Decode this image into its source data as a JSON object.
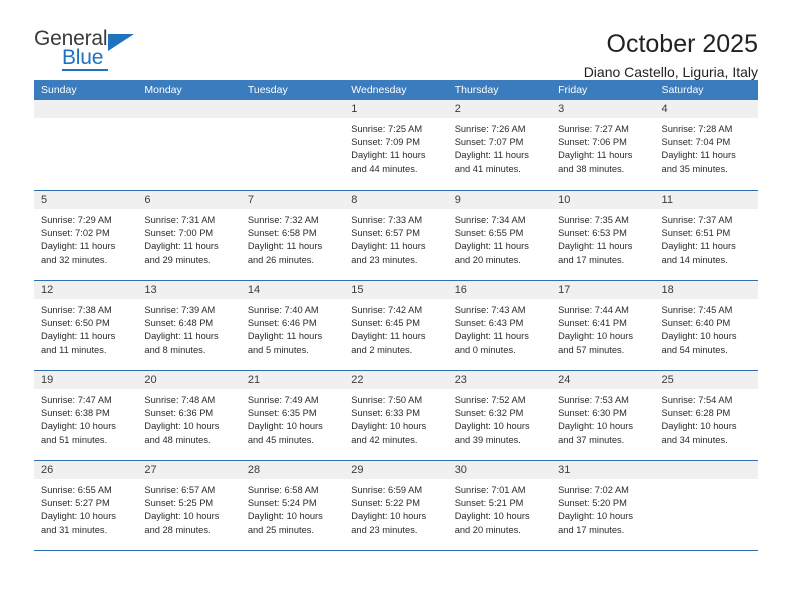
{
  "brand": {
    "name_top": "General",
    "name_bottom": "Blue",
    "accent_color": "#1f72bd",
    "triangle_icon": "triangle-icon"
  },
  "header": {
    "title": "October 2025",
    "subtitle": "Diano Castello, Liguria, Italy"
  },
  "calendar": {
    "header_bg": "#3a7cbe",
    "row_rule_color": "#2f6fb0",
    "day_strip_bg": "#f0f0f0",
    "weekdays": [
      "Sunday",
      "Monday",
      "Tuesday",
      "Wednesday",
      "Thursday",
      "Friday",
      "Saturday"
    ],
    "weeks": [
      [
        {
          "day": "",
          "lines": []
        },
        {
          "day": "",
          "lines": []
        },
        {
          "day": "",
          "lines": []
        },
        {
          "day": "1",
          "lines": [
            "Sunrise: 7:25 AM",
            "Sunset: 7:09 PM",
            "Daylight: 11 hours",
            "and 44 minutes."
          ]
        },
        {
          "day": "2",
          "lines": [
            "Sunrise: 7:26 AM",
            "Sunset: 7:07 PM",
            "Daylight: 11 hours",
            "and 41 minutes."
          ]
        },
        {
          "day": "3",
          "lines": [
            "Sunrise: 7:27 AM",
            "Sunset: 7:06 PM",
            "Daylight: 11 hours",
            "and 38 minutes."
          ]
        },
        {
          "day": "4",
          "lines": [
            "Sunrise: 7:28 AM",
            "Sunset: 7:04 PM",
            "Daylight: 11 hours",
            "and 35 minutes."
          ]
        }
      ],
      [
        {
          "day": "5",
          "lines": [
            "Sunrise: 7:29 AM",
            "Sunset: 7:02 PM",
            "Daylight: 11 hours",
            "and 32 minutes."
          ]
        },
        {
          "day": "6",
          "lines": [
            "Sunrise: 7:31 AM",
            "Sunset: 7:00 PM",
            "Daylight: 11 hours",
            "and 29 minutes."
          ]
        },
        {
          "day": "7",
          "lines": [
            "Sunrise: 7:32 AM",
            "Sunset: 6:58 PM",
            "Daylight: 11 hours",
            "and 26 minutes."
          ]
        },
        {
          "day": "8",
          "lines": [
            "Sunrise: 7:33 AM",
            "Sunset: 6:57 PM",
            "Daylight: 11 hours",
            "and 23 minutes."
          ]
        },
        {
          "day": "9",
          "lines": [
            "Sunrise: 7:34 AM",
            "Sunset: 6:55 PM",
            "Daylight: 11 hours",
            "and 20 minutes."
          ]
        },
        {
          "day": "10",
          "lines": [
            "Sunrise: 7:35 AM",
            "Sunset: 6:53 PM",
            "Daylight: 11 hours",
            "and 17 minutes."
          ]
        },
        {
          "day": "11",
          "lines": [
            "Sunrise: 7:37 AM",
            "Sunset: 6:51 PM",
            "Daylight: 11 hours",
            "and 14 minutes."
          ]
        }
      ],
      [
        {
          "day": "12",
          "lines": [
            "Sunrise: 7:38 AM",
            "Sunset: 6:50 PM",
            "Daylight: 11 hours",
            "and 11 minutes."
          ]
        },
        {
          "day": "13",
          "lines": [
            "Sunrise: 7:39 AM",
            "Sunset: 6:48 PM",
            "Daylight: 11 hours",
            "and 8 minutes."
          ]
        },
        {
          "day": "14",
          "lines": [
            "Sunrise: 7:40 AM",
            "Sunset: 6:46 PM",
            "Daylight: 11 hours",
            "and 5 minutes."
          ]
        },
        {
          "day": "15",
          "lines": [
            "Sunrise: 7:42 AM",
            "Sunset: 6:45 PM",
            "Daylight: 11 hours",
            "and 2 minutes."
          ]
        },
        {
          "day": "16",
          "lines": [
            "Sunrise: 7:43 AM",
            "Sunset: 6:43 PM",
            "Daylight: 11 hours",
            "and 0 minutes."
          ]
        },
        {
          "day": "17",
          "lines": [
            "Sunrise: 7:44 AM",
            "Sunset: 6:41 PM",
            "Daylight: 10 hours",
            "and 57 minutes."
          ]
        },
        {
          "day": "18",
          "lines": [
            "Sunrise: 7:45 AM",
            "Sunset: 6:40 PM",
            "Daylight: 10 hours",
            "and 54 minutes."
          ]
        }
      ],
      [
        {
          "day": "19",
          "lines": [
            "Sunrise: 7:47 AM",
            "Sunset: 6:38 PM",
            "Daylight: 10 hours",
            "and 51 minutes."
          ]
        },
        {
          "day": "20",
          "lines": [
            "Sunrise: 7:48 AM",
            "Sunset: 6:36 PM",
            "Daylight: 10 hours",
            "and 48 minutes."
          ]
        },
        {
          "day": "21",
          "lines": [
            "Sunrise: 7:49 AM",
            "Sunset: 6:35 PM",
            "Daylight: 10 hours",
            "and 45 minutes."
          ]
        },
        {
          "day": "22",
          "lines": [
            "Sunrise: 7:50 AM",
            "Sunset: 6:33 PM",
            "Daylight: 10 hours",
            "and 42 minutes."
          ]
        },
        {
          "day": "23",
          "lines": [
            "Sunrise: 7:52 AM",
            "Sunset: 6:32 PM",
            "Daylight: 10 hours",
            "and 39 minutes."
          ]
        },
        {
          "day": "24",
          "lines": [
            "Sunrise: 7:53 AM",
            "Sunset: 6:30 PM",
            "Daylight: 10 hours",
            "and 37 minutes."
          ]
        },
        {
          "day": "25",
          "lines": [
            "Sunrise: 7:54 AM",
            "Sunset: 6:28 PM",
            "Daylight: 10 hours",
            "and 34 minutes."
          ]
        }
      ],
      [
        {
          "day": "26",
          "lines": [
            "Sunrise: 6:55 AM",
            "Sunset: 5:27 PM",
            "Daylight: 10 hours",
            "and 31 minutes."
          ]
        },
        {
          "day": "27",
          "lines": [
            "Sunrise: 6:57 AM",
            "Sunset: 5:25 PM",
            "Daylight: 10 hours",
            "and 28 minutes."
          ]
        },
        {
          "day": "28",
          "lines": [
            "Sunrise: 6:58 AM",
            "Sunset: 5:24 PM",
            "Daylight: 10 hours",
            "and 25 minutes."
          ]
        },
        {
          "day": "29",
          "lines": [
            "Sunrise: 6:59 AM",
            "Sunset: 5:22 PM",
            "Daylight: 10 hours",
            "and 23 minutes."
          ]
        },
        {
          "day": "30",
          "lines": [
            "Sunrise: 7:01 AM",
            "Sunset: 5:21 PM",
            "Daylight: 10 hours",
            "and 20 minutes."
          ]
        },
        {
          "day": "31",
          "lines": [
            "Sunrise: 7:02 AM",
            "Sunset: 5:20 PM",
            "Daylight: 10 hours",
            "and 17 minutes."
          ]
        },
        {
          "day": "",
          "lines": []
        }
      ]
    ]
  }
}
